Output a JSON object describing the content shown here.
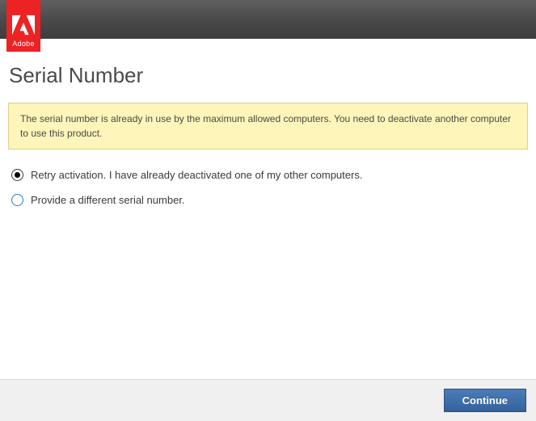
{
  "brand": {
    "name": "Adobe"
  },
  "page": {
    "title": "Serial Number"
  },
  "alert": {
    "message": "The serial number is already in use by the maximum allowed computers. You need to deactivate another computer to use this product."
  },
  "options": {
    "retry": {
      "label": "Retry activation. I have already deactivated one of my other computers.",
      "selected": true
    },
    "provide": {
      "label": "Provide a different serial number.",
      "selected": false
    }
  },
  "footer": {
    "continue_label": "Continue"
  },
  "colors": {
    "brand_red": "#ed2224",
    "alert_bg": "#fdf5b9",
    "button_blue": "#34619d"
  }
}
